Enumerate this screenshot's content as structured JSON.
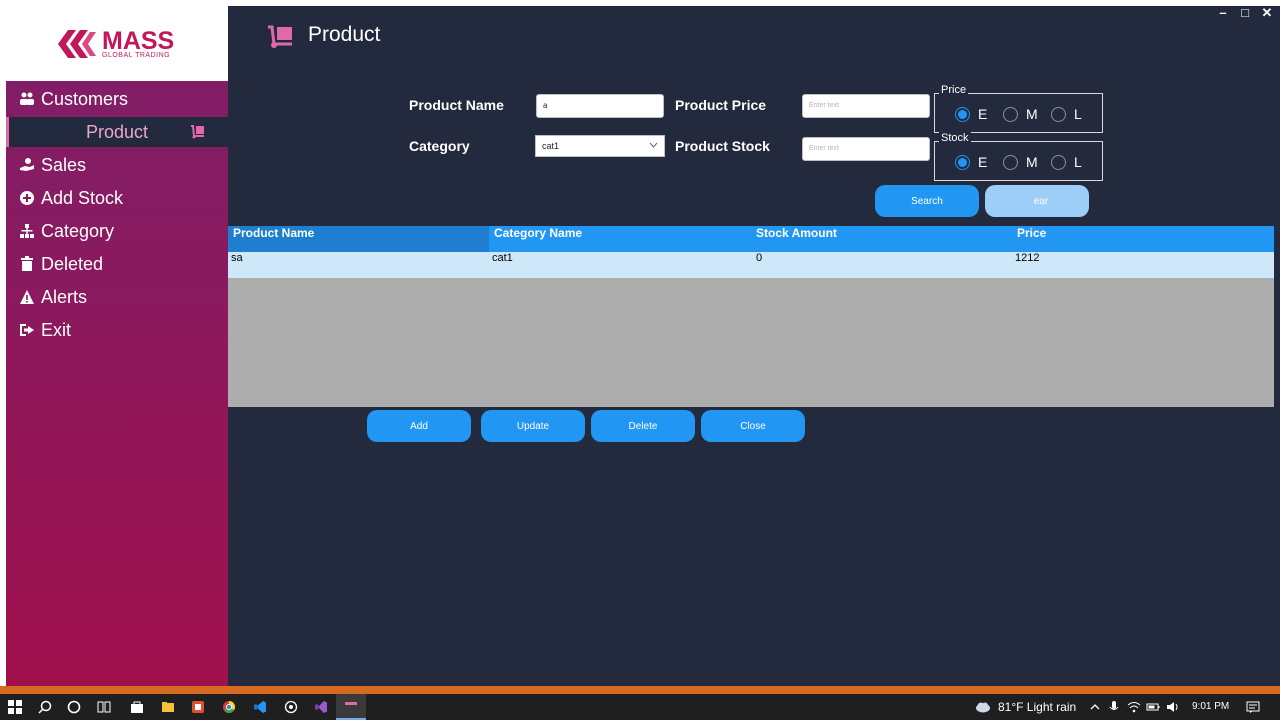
{
  "window": {
    "title": "Product"
  },
  "logo": {
    "name": "MASS",
    "tagline": "GLOBAL TRADING"
  },
  "sidebar": {
    "items": [
      {
        "label": "Customers",
        "icon": "users-icon"
      },
      {
        "label": "Product",
        "icon": "dolly-icon",
        "active": true
      },
      {
        "label": "Sales",
        "icon": "hand-coin-icon"
      },
      {
        "label": "Add Stock",
        "icon": "plus-circle-icon"
      },
      {
        "label": "Category",
        "icon": "sitemap-icon"
      },
      {
        "label": "Deleted",
        "icon": "trash-icon"
      },
      {
        "label": "Alerts",
        "icon": "warning-icon"
      },
      {
        "label": "Exit",
        "icon": "sign-out-icon"
      }
    ]
  },
  "form": {
    "product_name": {
      "label": "Product Name",
      "value": "a"
    },
    "product_price": {
      "label": "Product Price",
      "placeholder": "Enter text"
    },
    "category": {
      "label": "Category",
      "value": "cat1"
    },
    "product_stock": {
      "label": "Product Stock",
      "placeholder": "Enter text"
    },
    "price_group": {
      "title": "Price",
      "options": [
        "E",
        "M",
        "L"
      ],
      "selected": "E"
    },
    "stock_group": {
      "title": "Stock",
      "options": [
        "E",
        "M",
        "L"
      ],
      "selected": "E"
    },
    "search_label": "Search",
    "clear_label": "ear"
  },
  "table": {
    "columns": [
      "Product Name",
      "Category Name",
      "Stock Amount",
      "Price"
    ],
    "rows": [
      [
        "sa",
        "cat1",
        "0",
        "1212"
      ]
    ]
  },
  "actions": {
    "add": "Add",
    "update": "Update",
    "delete": "Delete",
    "close": "Close"
  },
  "taskbar": {
    "weather": "81°F  Light rain",
    "time": "9:01 PM"
  },
  "colors": {
    "accent": "#2196f3",
    "sidebar": "#8a1a5f",
    "background": "#242a3d",
    "brand": "#c2185b"
  }
}
